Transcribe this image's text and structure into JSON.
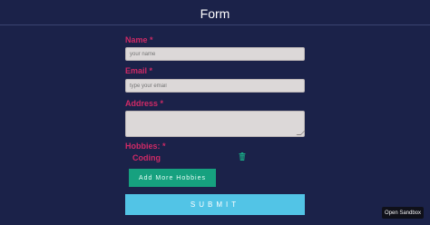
{
  "header": {
    "title": "Form"
  },
  "form": {
    "name_label": "Name *",
    "name_placeholder": "your name",
    "email_label": "Email *",
    "email_placeholder": "type your email",
    "address_label": "Address *",
    "hobbies_label": "Hobbies: *",
    "hobbies": [
      {
        "label": "Coding"
      }
    ],
    "add_hobbies_label": "Add More Hobbies",
    "submit_label": "SUBMIT"
  },
  "sandbox": {
    "label": "Open Sandbox"
  },
  "icons": {
    "delete": "trash-icon"
  },
  "colors": {
    "background": "#1b2249",
    "label": "#cf2a66",
    "add_button": "#16a17f",
    "submit_button": "#52c4e6",
    "trash": "#1aa684"
  }
}
